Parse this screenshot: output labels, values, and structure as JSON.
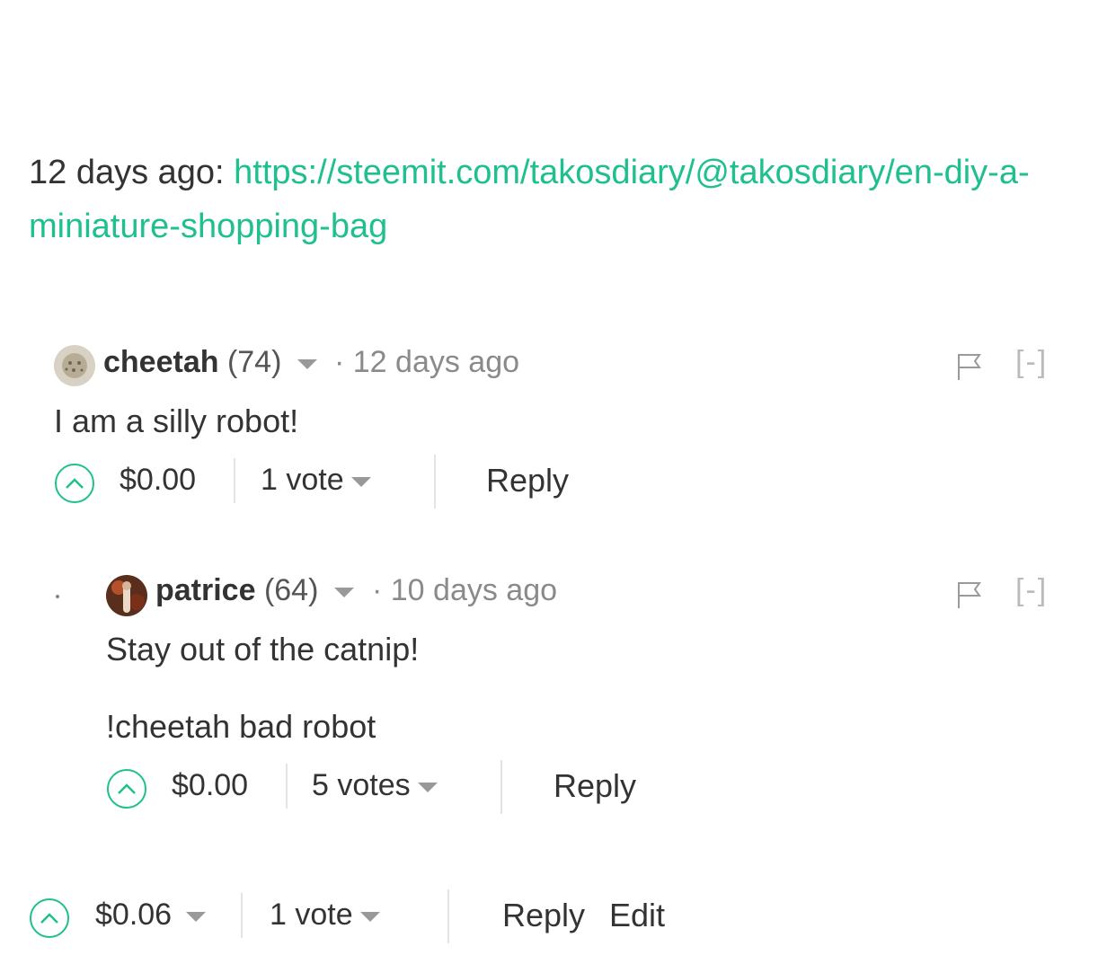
{
  "post": {
    "time_prefix": "12 days ago: ",
    "link": "https://steemit.com/takosdiary/@takosdiary/en-diy-a-miniature-shopping-bag"
  },
  "comments": [
    {
      "author": "cheetah",
      "reputation": "(74)",
      "time": "· 12 days ago",
      "body": [
        "I am a silly robot!"
      ],
      "payout": "$0.00",
      "votes": "1 vote",
      "reply_label": "Reply",
      "collapse_label": "[-]"
    },
    {
      "author": "patrice",
      "reputation": "(64)",
      "time": "· 10 days ago",
      "body": [
        "Stay out of the catnip!",
        "!cheetah bad robot"
      ],
      "payout": "$0.00",
      "votes": "5 votes",
      "reply_label": "Reply",
      "collapse_label": "[-]"
    }
  ],
  "footer": {
    "payout": "$0.06",
    "votes": "1 vote",
    "reply_label": "Reply",
    "edit_label": "Edit"
  },
  "colors": {
    "accent": "#1fbf8f",
    "text": "#333333",
    "muted": "#8a8a8a"
  }
}
